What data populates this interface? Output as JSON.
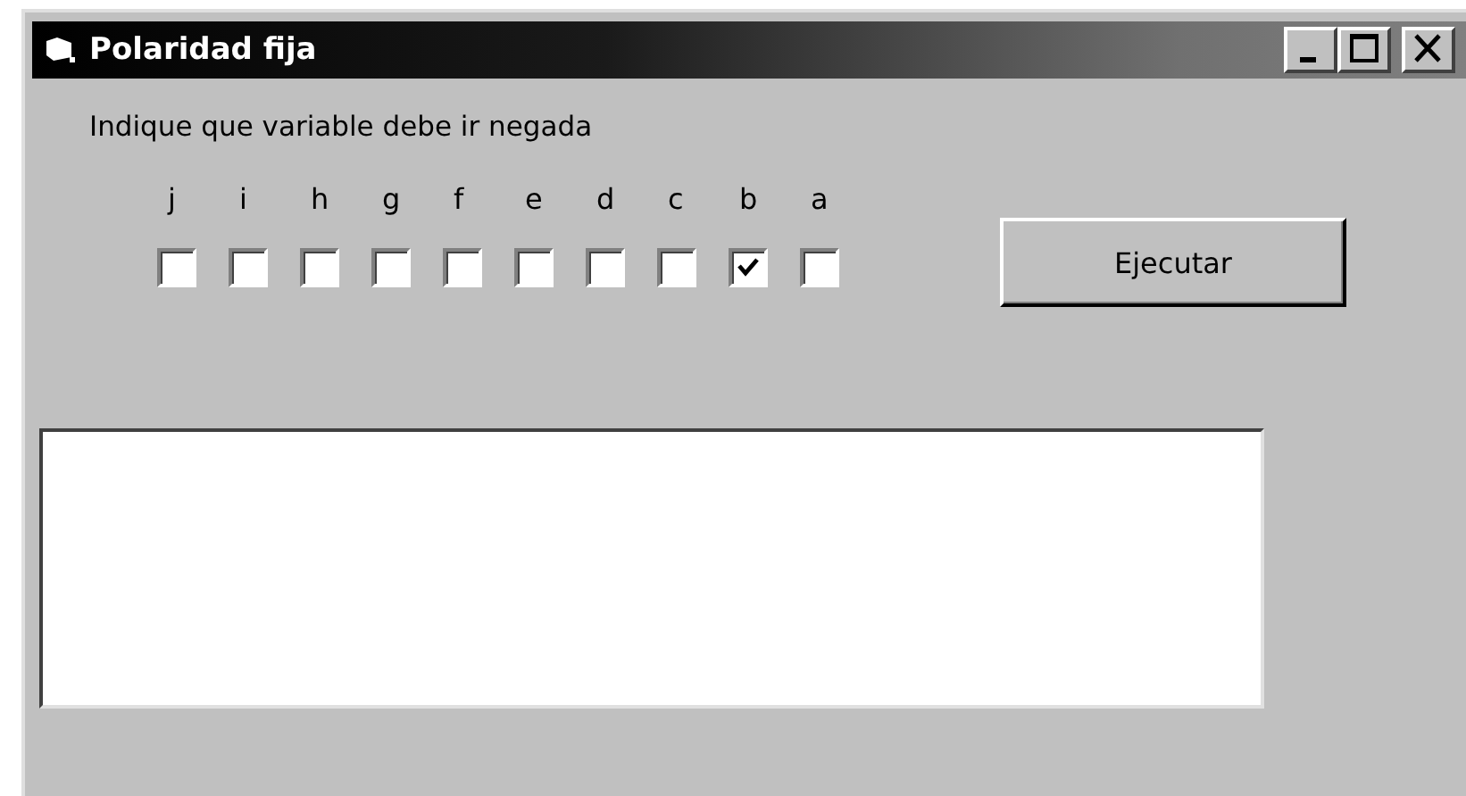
{
  "window": {
    "title": "Polaridad fija"
  },
  "prompt": "Indique que variable debe ir negada",
  "variables": [
    {
      "label": "j",
      "checked": false
    },
    {
      "label": "i",
      "checked": false
    },
    {
      "label": "h",
      "checked": false
    },
    {
      "label": "g",
      "checked": false
    },
    {
      "label": "f",
      "checked": false
    },
    {
      "label": "e",
      "checked": false
    },
    {
      "label": "d",
      "checked": false
    },
    {
      "label": "c",
      "checked": false
    },
    {
      "label": "b",
      "checked": true
    },
    {
      "label": "a",
      "checked": false
    }
  ],
  "run_button": "Ejecutar"
}
